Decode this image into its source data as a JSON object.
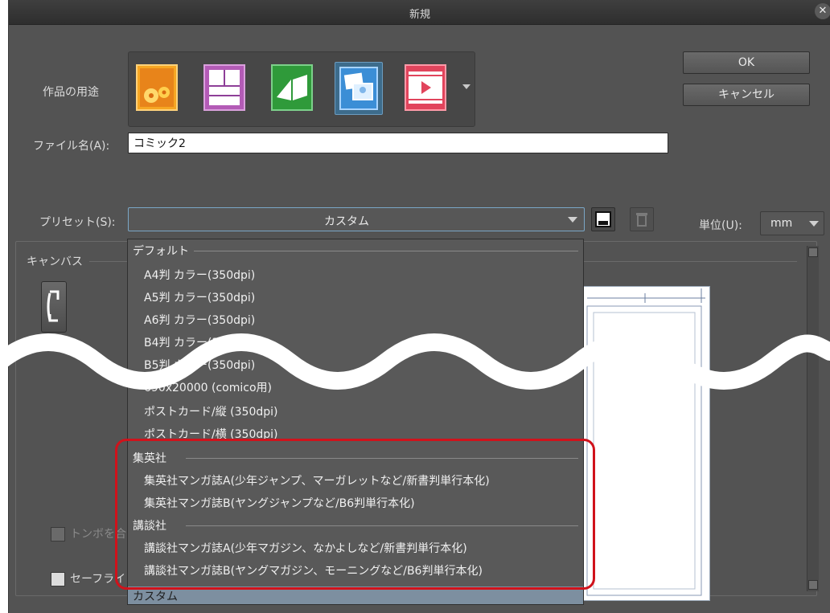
{
  "window": {
    "title": "新規",
    "close_icon": "close-icon"
  },
  "purpose": {
    "label": "作品の用途",
    "tiles": [
      {
        "name": "illustration",
        "icon": "illustration-icon",
        "selected": false,
        "colors": [
          "#f6a623",
          "#d66a12"
        ]
      },
      {
        "name": "comic",
        "icon": "comic-icon",
        "selected": false,
        "colors": [
          "#b35bb6",
          "#8e3f98"
        ]
      },
      {
        "name": "book",
        "icon": "book-icon",
        "selected": false,
        "colors": [
          "#2f9a3a",
          "#1e7a2b"
        ]
      },
      {
        "name": "webtoon-photo",
        "icon": "photo-icon",
        "selected": true,
        "colors": [
          "#3b8ed6",
          "#2364a8"
        ]
      },
      {
        "name": "animation",
        "icon": "animation-icon",
        "selected": false,
        "colors": [
          "#e1445c",
          "#b7203a"
        ]
      }
    ],
    "more_icon": "chevron-down-icon"
  },
  "buttons": {
    "ok": "OK",
    "cancel": "キャンセル"
  },
  "filename": {
    "label": "ファイル名(A):",
    "value": "コミック2"
  },
  "preset": {
    "label": "プリセット(S):",
    "value": "カスタム",
    "save_icon": "save-preset-icon",
    "delete_icon": "trash-icon"
  },
  "unit": {
    "label": "単位(U):",
    "value": "mm"
  },
  "canvas": {
    "legend": "キャンバス"
  },
  "checkboxes": [
    {
      "label": "トンボを合",
      "checked": false
    },
    {
      "label": "セーフライ",
      "checked": false
    }
  ],
  "dropdown": {
    "groups": [
      {
        "header": "デフォルト",
        "items": [
          "A4判 カラー(350dpi)",
          "A5判 カラー(350dpi)",
          "A6判 カラー(350dpi)",
          "B4判 カラー(350dpi)",
          "B5判 カラー(350dpi)",
          "690x20000 (comico用)",
          "ポストカード/縦 (350dpi)",
          "ポストカード/横 (350dpi)"
        ]
      },
      {
        "header": "集英社",
        "items": [
          "集英社マンガ誌A(少年ジャンプ、マーガレットなど/新書判単行本化)",
          "集英社マンガ誌B(ヤングジャンプなど/B6判単行本化)"
        ]
      },
      {
        "header": "講談社",
        "items": [
          "講談社マンガ誌A(少年マガジン、なかよしなど/新書判単行本化)",
          "講談社マンガ誌B(ヤングマガジン、モーニングなど/B6判単行本化)"
        ]
      }
    ],
    "footer": "カスタム"
  },
  "colors": {
    "dialog_bg": "#535353",
    "highlight_border": "#d0121b",
    "selected_tile": "#3d6c8c",
    "dropdown_footer": "#7d8fa0"
  }
}
